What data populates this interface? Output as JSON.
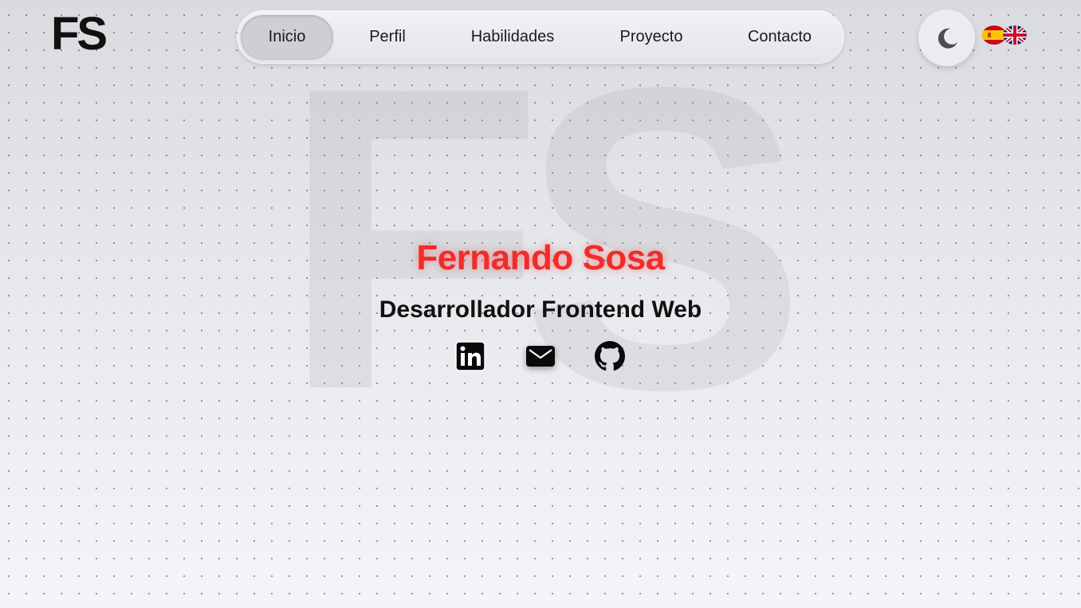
{
  "logo": {
    "text": "FS"
  },
  "watermark": {
    "text": "FS"
  },
  "nav": {
    "items": [
      {
        "label": "Inicio",
        "active": true
      },
      {
        "label": "Perfil",
        "active": false
      },
      {
        "label": "Habilidades",
        "active": false
      },
      {
        "label": "Proyecto",
        "active": false
      },
      {
        "label": "Contacto",
        "active": false
      }
    ]
  },
  "theme_toggle": {
    "icon": "moon-icon"
  },
  "languages": [
    {
      "code": "es",
      "icon": "spain-flag-icon"
    },
    {
      "code": "en",
      "icon": "uk-flag-icon"
    }
  ],
  "hero": {
    "name": "Fernando Sosa",
    "role": "Desarrollador Frontend Web"
  },
  "socials": [
    {
      "icon": "linkedin-icon"
    },
    {
      "icon": "email-icon"
    },
    {
      "icon": "github-icon"
    }
  ],
  "colors": {
    "accent": "#f22b2b",
    "text": "#111111",
    "nav_background": "#e8e9ed",
    "nav_active": "#cdcfd4"
  }
}
